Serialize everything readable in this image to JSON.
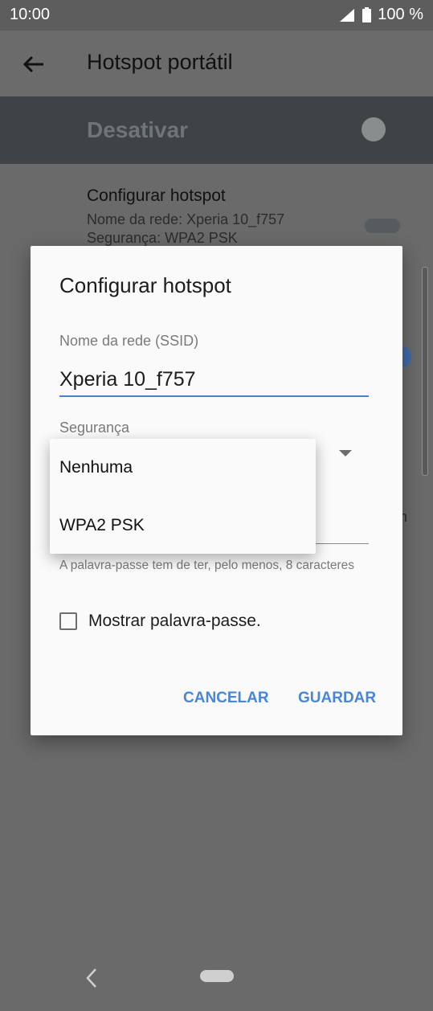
{
  "status_bar": {
    "time": "10:00",
    "battery_text": "100 %",
    "signal_icon": "signal-icon",
    "battery_icon": "battery-icon"
  },
  "app_bar": {
    "title": "Hotspot portátil",
    "back_icon": "arrow-left-icon"
  },
  "master_switch": {
    "label": "Desativar",
    "state": "off"
  },
  "settings": {
    "configure": {
      "title": "Configurar hotspot",
      "network_name": "Nome da rede: Xperia 10_f757",
      "security": "Segurança: WPA2 PSK"
    },
    "partial_right_text": "n"
  },
  "dialog": {
    "title": "Configurar hotspot",
    "ssid_label": "Nome da rede (SSID)",
    "ssid_value": "Xperia 10_f757",
    "security_label": "Segurança",
    "password_hint": "A palavra-passe tem de ter, pelo menos, 8 caracteres",
    "show_password_label": "Mostrar palavra-passe.",
    "show_password_checked": false,
    "cancel_label": "CANCELAR",
    "save_label": "GUARDAR"
  },
  "security_menu": {
    "options": [
      "Nenhuma",
      "WPA2 PSK"
    ]
  },
  "colors": {
    "accent": "#4a86d8",
    "scrim": "#6a6a6a",
    "dialog_bg": "#fafafa"
  }
}
